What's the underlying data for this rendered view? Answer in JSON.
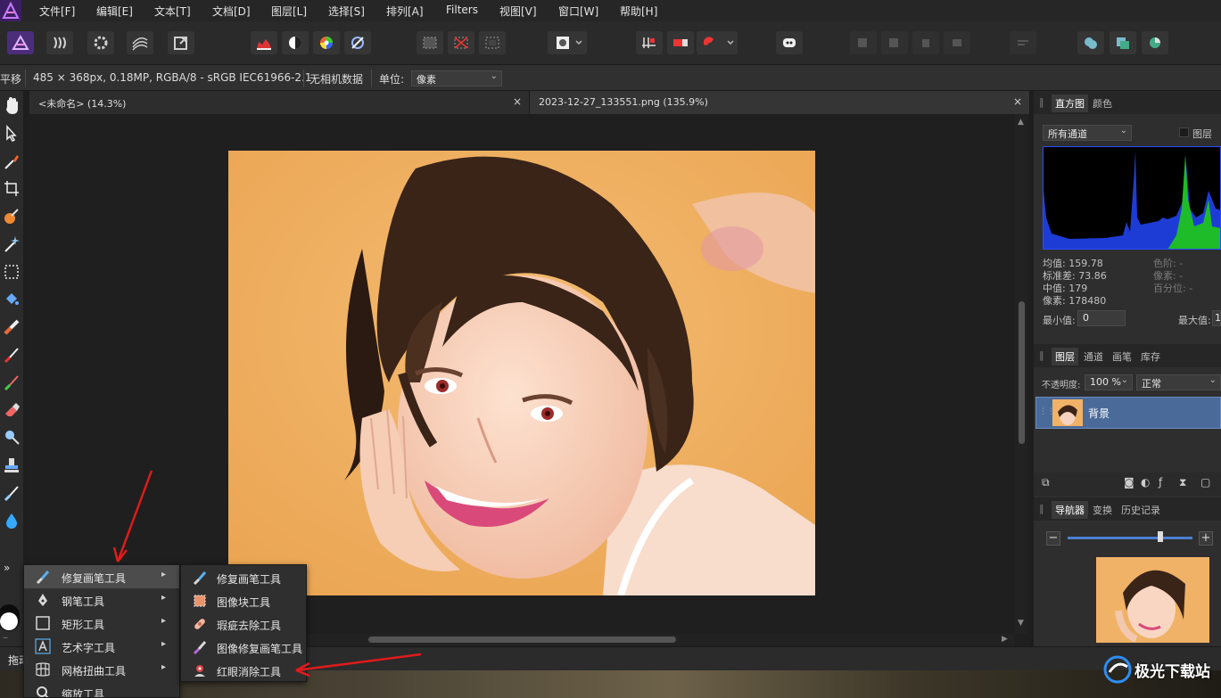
{
  "menubar": {
    "items": [
      "文件[F]",
      "编辑[E]",
      "文本[T]",
      "文档[D]",
      "图层[L]",
      "选择[S]",
      "排列[A]",
      "Filters",
      "视图[V]",
      "窗口[W]",
      "帮助[H]"
    ]
  },
  "context_bar": {
    "tool_name": "平移",
    "image_info": "485 × 368px, 0.18MP, RGBA/8 - sRGB IEC61966-2.1",
    "camera_info": "无相机数据",
    "unit_label": "单位:",
    "unit_value": "像素"
  },
  "documents": {
    "tab1": "<未命名> (14.3%)",
    "tab2": "2023-12-27_133551.png (135.9%)",
    "close_glyph": "×"
  },
  "histogram_panel": {
    "tabs": [
      "直方图",
      "颜色"
    ],
    "channel_select": "所有通道",
    "layer_checkbox_label": "图层",
    "mean": "均值: 159.78",
    "stddev": "标准差: 73.86",
    "median": "中值: 179",
    "pixels": "像素: 178480",
    "level": "色阶: -",
    "pixels_r": "像素: -",
    "percentile": "百分位: -",
    "min_label": "最小值:",
    "min_value": "0",
    "max_label": "最大值:",
    "max_value": "1"
  },
  "layers_panel": {
    "tabs": [
      "图层",
      "通道",
      "画笔",
      "库存"
    ],
    "opacity_label": "不透明度:",
    "opacity_value": "100 %",
    "blend_mode": "正常",
    "layer_name": "背景"
  },
  "navigator_panel": {
    "tabs": [
      "导航器",
      "变换",
      "历史记录"
    ],
    "minus": "−",
    "plus": "+"
  },
  "flyout_left": {
    "items": [
      {
        "label": "修复画笔工具",
        "icon": "healing-brush-icon"
      },
      {
        "label": "钢笔工具",
        "icon": "pen-icon"
      },
      {
        "label": "矩形工具",
        "icon": "rectangle-icon"
      },
      {
        "label": "艺术字工具",
        "icon": "artistic-text-icon"
      },
      {
        "label": "网格扭曲工具",
        "icon": "mesh-warp-icon"
      },
      {
        "label": "缩放工具",
        "icon": "zoom-icon"
      }
    ],
    "arrow": "▸"
  },
  "flyout_right": {
    "items": [
      {
        "label": "修复画笔工具",
        "icon": "healing-brush-icon"
      },
      {
        "label": "图像块工具",
        "icon": "patch-icon"
      },
      {
        "label": "瑕疵去除工具",
        "icon": "blemish-removal-icon"
      },
      {
        "label": "图像修复画笔工具",
        "icon": "inpainting-brush-icon"
      },
      {
        "label": "红眼消除工具",
        "icon": "red-eye-icon"
      }
    ]
  },
  "bottom": {
    "drag_hint": "拖动",
    "expand_glyph": "»"
  },
  "watermark": {
    "text": "极光下载站"
  },
  "colors": {
    "accent_red": "#e01b1b",
    "layer_selected": "#4a6a99",
    "histogram_blue": "#1d3cd6",
    "histogram_green": "#1fc31f"
  }
}
